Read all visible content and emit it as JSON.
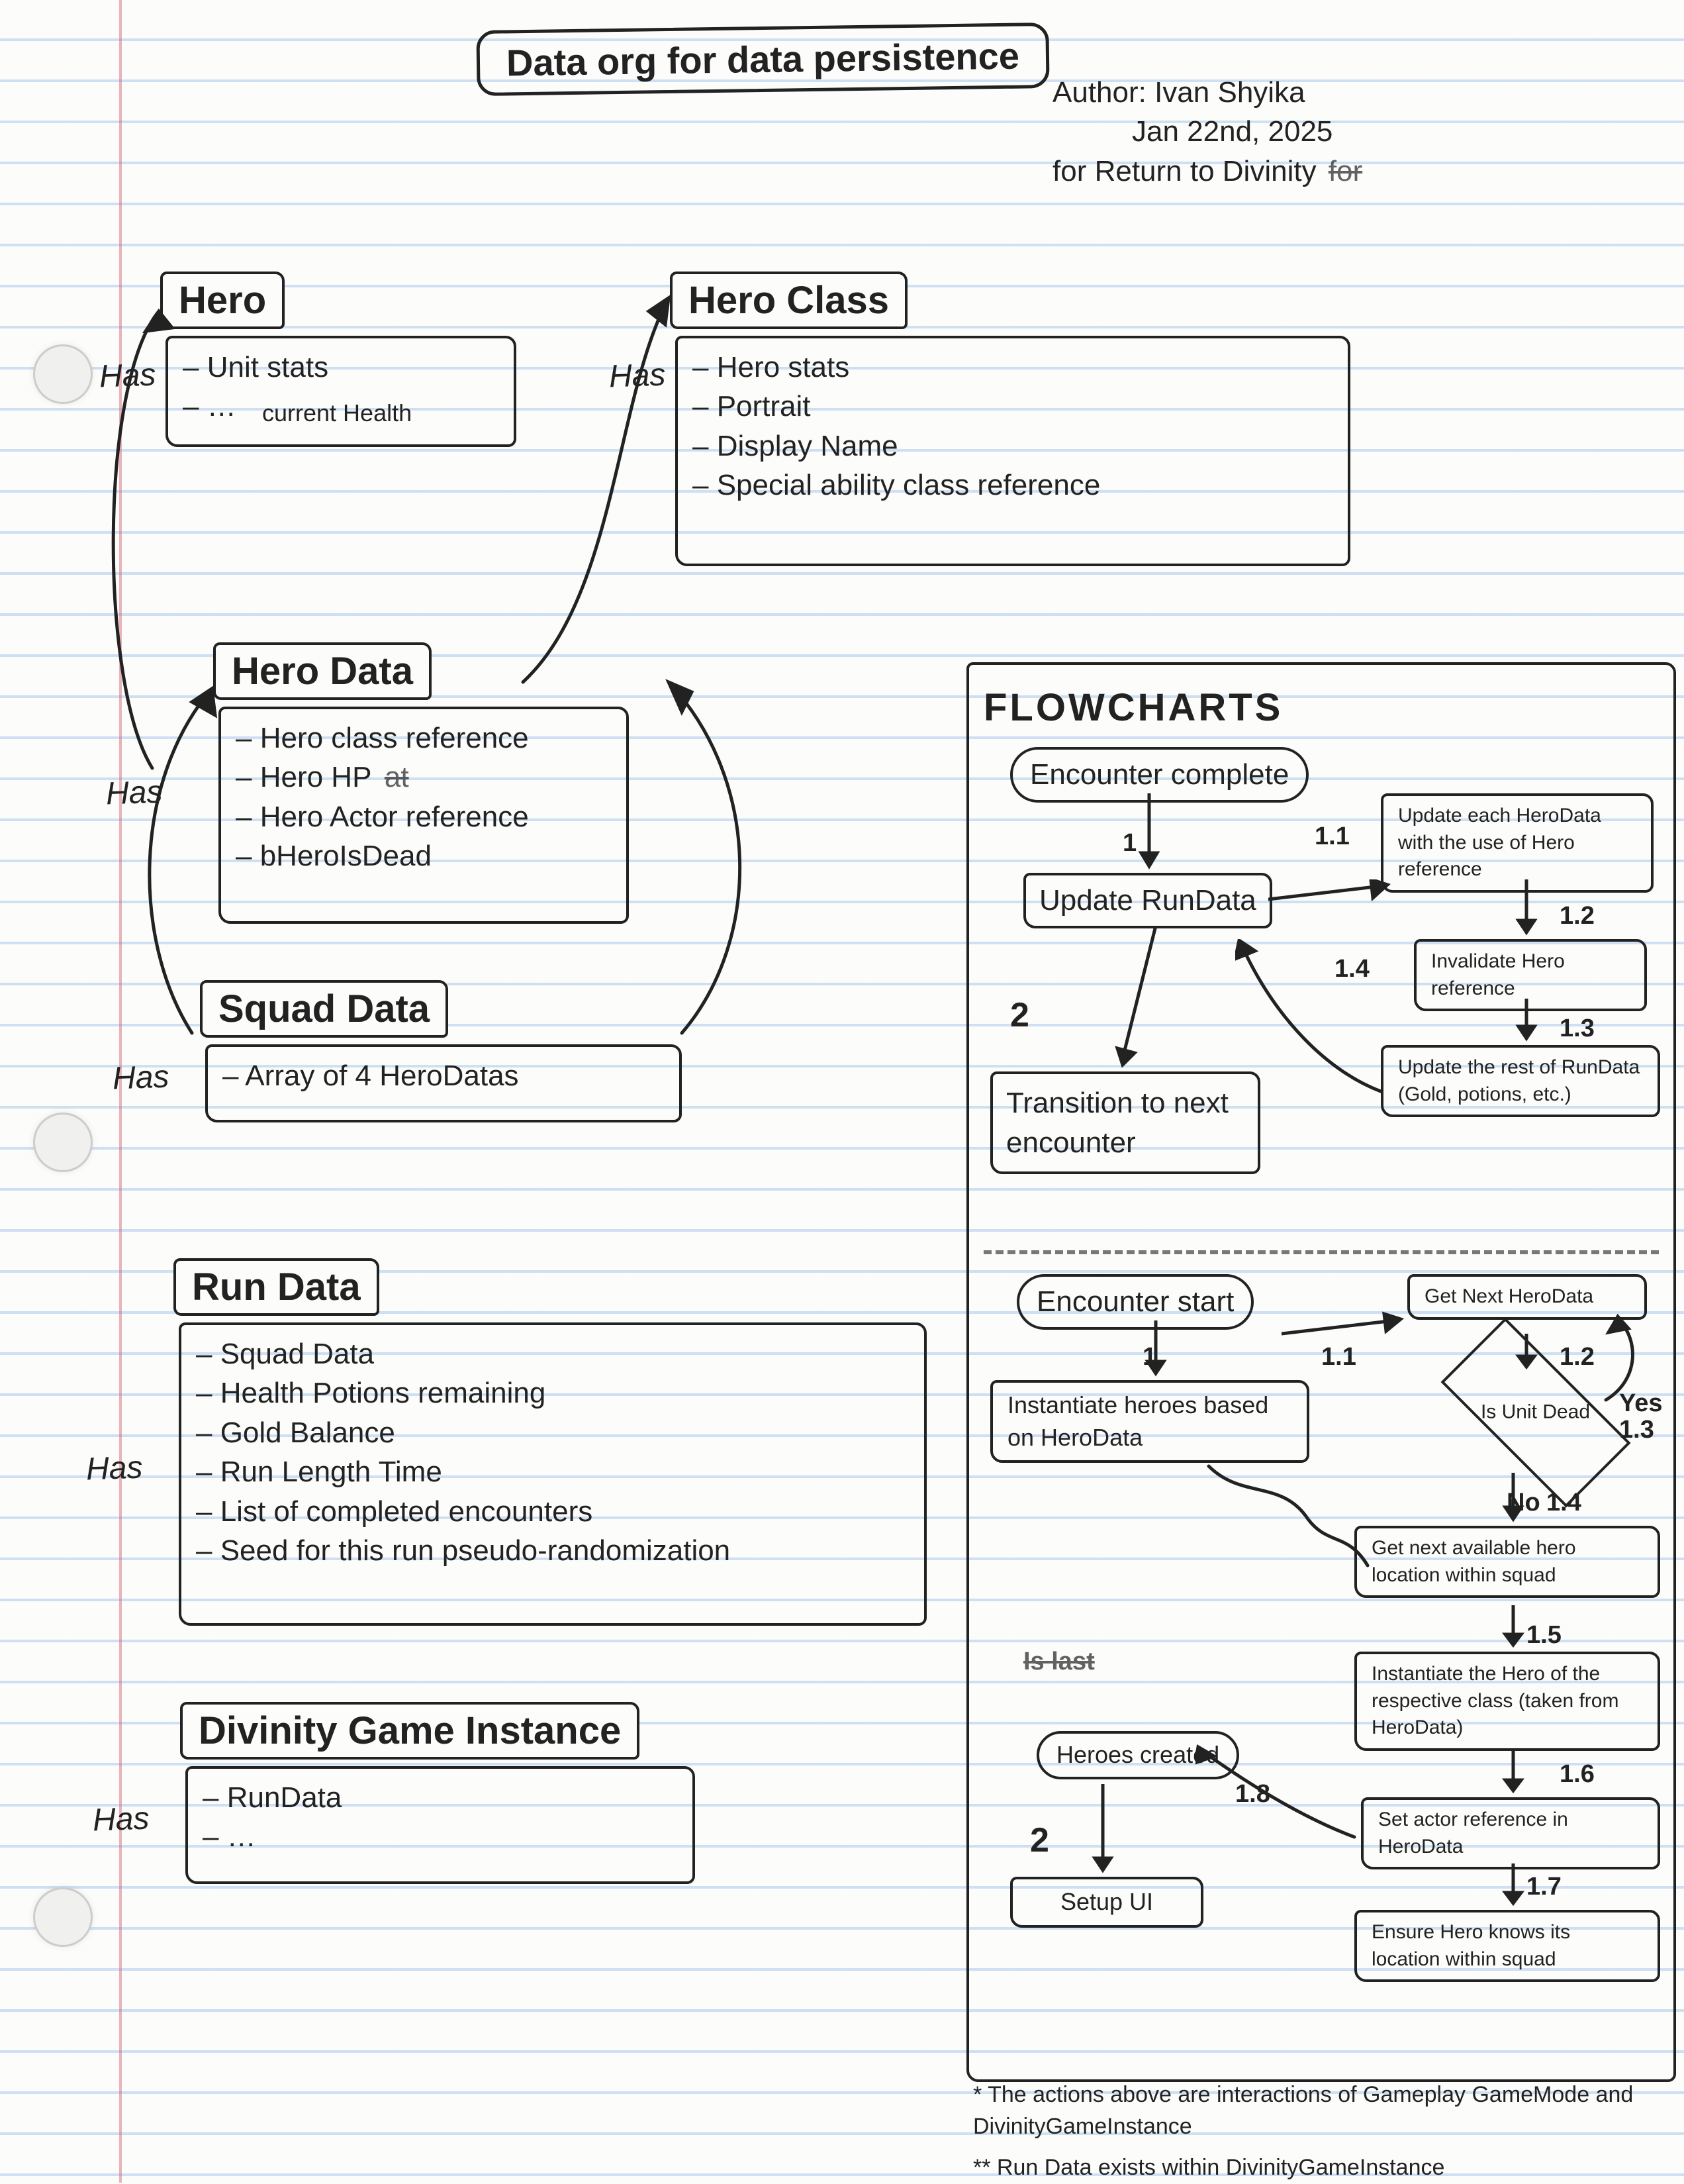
{
  "title": "Data org for data persistence",
  "meta": {
    "author_label": "Author: Ivan Shyika",
    "date": "Jan 22nd, 2025",
    "project": "for Return to Divinity",
    "project_strike": "for"
  },
  "has_label": "Has",
  "data_model": {
    "hero": {
      "title": "Hero",
      "items": [
        "Unit stats",
        "…"
      ],
      "annotation": "current Health"
    },
    "hero_class": {
      "title": "Hero Class",
      "items": [
        "Hero stats",
        "Portrait",
        "Display Name",
        "Special ability class reference"
      ]
    },
    "hero_data": {
      "title": "Hero Data",
      "items": [
        "Hero class reference",
        "Hero HP",
        "Hero Actor reference",
        "bHeroIsDead"
      ],
      "strike_after_hp": "at"
    },
    "squad_data": {
      "title": "Squad Data",
      "items": [
        "Array of 4 HeroDatas"
      ]
    },
    "run_data": {
      "title": "Run Data",
      "items": [
        "Squad Data",
        "Health Potions remaining",
        "Gold Balance",
        "Run Length Time",
        "List of completed encounters",
        "Seed for this run pseudo-randomization"
      ],
      "seed_strike": "pseudo"
    },
    "game_instance": {
      "title": "Divinity Game Instance",
      "items": [
        "RunData",
        "…"
      ]
    }
  },
  "flowcharts": {
    "title": "FLOWCHARTS",
    "top": {
      "start": "Encounter complete",
      "update_run_data": "Update RunData",
      "transition": "Transition to next encounter",
      "side_1_1": "Update each HeroData with the use of Hero reference",
      "side_1_2": "Invalidate Hero reference",
      "side_1_3": "Update the rest of RunData (Gold, potions, etc.)",
      "labels": {
        "one": "1",
        "one_one": "1.1",
        "one_two": "1.2",
        "one_three": "1.3",
        "one_four": "1.4",
        "two": "2"
      }
    },
    "bottom": {
      "start": "Encounter start",
      "instantiate": "Instantiate heroes based on HeroData",
      "get_next_hero": "Get Next HeroData",
      "decision": "Is Unit Dead",
      "yes": "Yes",
      "no": "No",
      "get_location": "Get next available hero location within squad",
      "instantiate_class": "Instantiate the Hero of the respective class (taken from HeroData)",
      "set_actor": "Set actor reference in HeroData",
      "ensure_location": "Ensure Hero knows its location within squad",
      "heroes_created": "Heroes created",
      "setup_ui": "Setup UI",
      "labels": {
        "one": "1",
        "one_one": "1.1",
        "one_two": "1.2",
        "one_three": "1.3",
        "one_four": "1.4",
        "one_five": "1.5",
        "one_six": "1.6",
        "one_seven": "1.7",
        "one_eight": "1.8",
        "two": "2"
      },
      "is_last": "Is last"
    }
  },
  "footnotes": {
    "star1": "* The actions above are interactions of Gameplay GameMode and DivinityGameInstance",
    "star2": "** Run Data exists within DivinityGameInstance"
  }
}
